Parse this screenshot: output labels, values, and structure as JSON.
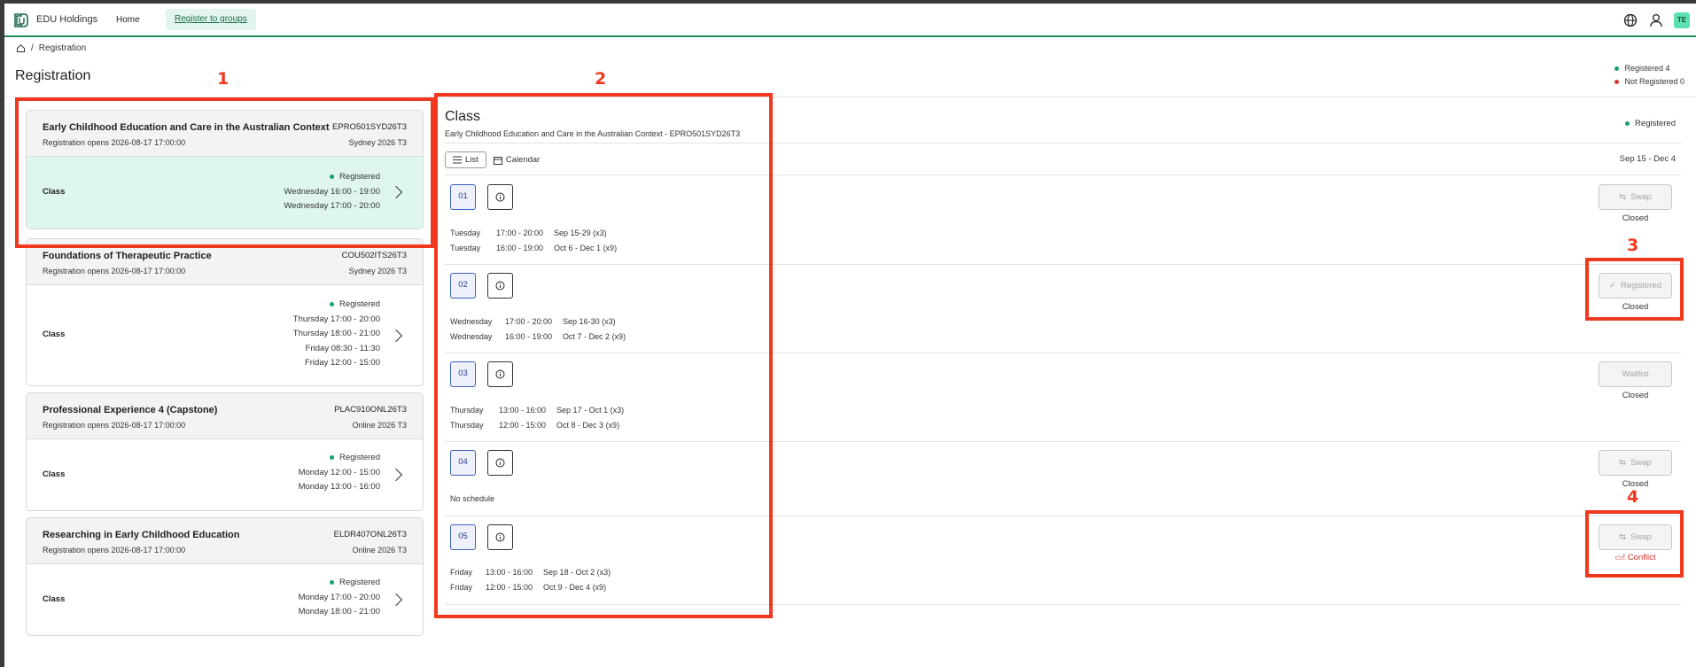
{
  "header": {
    "brand": "EDU Holdings",
    "nav_home": "Home",
    "nav_register": "Register to groups",
    "avatar_initials": "TE",
    "icons": [
      "globe-icon",
      "user-icon"
    ]
  },
  "breadcrumb": {
    "page": "Registration"
  },
  "page_title": "Registration",
  "summary": {
    "registered": "Registered 4",
    "not_registered": "Not Registered 0"
  },
  "courses": [
    {
      "name": "Early Childhood Education and Care in the Australian Context",
      "code": "EPRO501SYD26T3",
      "opens": "Registration opens 2026-08-17 17:00:00",
      "term": "Sydney 2026 T3",
      "class_label": "Class",
      "status": "Registered",
      "times": [
        "Wednesday 16:00 - 19:00",
        "Wednesday 17:00 - 20:00"
      ]
    },
    {
      "name": "Foundations of Therapeutic Practice",
      "code": "COU502ITS26T3",
      "opens": "Registration opens 2026-08-17 17:00:00",
      "term": "Sydney 2026 T3",
      "class_label": "Class",
      "status": "Registered",
      "times": [
        "Thursday 17:00 - 20:00",
        "Thursday 18:00 - 21:00",
        "Friday 08:30 - 11:30",
        "Friday 12:00 - 15:00"
      ]
    },
    {
      "name": "Professional Experience 4 (Capstone)",
      "code": "PLAC910ONL26T3",
      "opens": "Registration opens 2026-08-17 17:00:00",
      "term": "Online 2026 T3",
      "class_label": "Class",
      "status": "Registered",
      "times": [
        "Monday 12:00 - 15:00",
        "Monday 13:00 - 16:00"
      ]
    },
    {
      "name": "Researching in Early Childhood Education",
      "code": "ELDR407ONL26T3",
      "opens": "Registration opens 2026-08-17 17:00:00",
      "term": "Online 2026 T3",
      "class_label": "Class",
      "status": "Registered",
      "times": [
        "Monday 17:00 - 20:00",
        "Monday 18:00 - 21:00"
      ]
    }
  ],
  "class_panel": {
    "title": "Class",
    "subtitle": "Early Childhood Education and Care in the Australian Context - EPRO501SYD26T3",
    "status": "Registered",
    "view_list": "List",
    "view_calendar": "Calendar",
    "date_range": "Sep 15 - Dec 4",
    "groups": [
      {
        "num": "01",
        "schedule": [
          {
            "day": "Tuesday",
            "time": "17:00 - 20:00",
            "dates": "Sep 15-29 (x3)"
          },
          {
            "day": "Tuesday",
            "time": "16:00 - 19:00",
            "dates": "Oct 6 - Dec 1 (x9)"
          }
        ],
        "action": "Swap",
        "action_icon": "swap-icon",
        "note": "Closed"
      },
      {
        "num": "02",
        "schedule": [
          {
            "day": "Wednesday",
            "time": "17:00 - 20:00",
            "dates": "Sep 16-30 (x3)"
          },
          {
            "day": "Wednesday",
            "time": "16:00 - 19:00",
            "dates": "Oct 7 - Dec 2 (x9)"
          }
        ],
        "action": "Registered",
        "action_icon": "check-icon",
        "note": "Closed"
      },
      {
        "num": "03",
        "schedule": [
          {
            "day": "Thursday",
            "time": "13:00 - 16:00",
            "dates": "Sep 17 - Oct 1 (x3)"
          },
          {
            "day": "Thursday",
            "time": "12:00 - 15:00",
            "dates": "Oct 8 - Dec 3 (x9)"
          }
        ],
        "action": "Waitlist",
        "action_icon": "",
        "note": "Closed"
      },
      {
        "num": "04",
        "no_schedule": "No schedule",
        "schedule": [],
        "action": "Swap",
        "action_icon": "swap-icon",
        "note": "Closed"
      },
      {
        "num": "05",
        "schedule": [
          {
            "day": "Friday",
            "time": "13:00 - 16:00",
            "dates": "Sep 18 - Oct 2 (x3)"
          },
          {
            "day": "Friday",
            "time": "12:00 - 15:00",
            "dates": "Oct 9 - Dec 4 (x9)"
          }
        ],
        "action": "Swap",
        "action_icon": "swap-icon",
        "note": "Conflict"
      }
    ]
  },
  "annotations": [
    "1",
    "2",
    "3",
    "4"
  ],
  "colors": {
    "accent_green": "#16a36a",
    "conflict_red": "#d8322b",
    "annotation_red": "#f0381f",
    "active_bg": "#dff6ec"
  }
}
